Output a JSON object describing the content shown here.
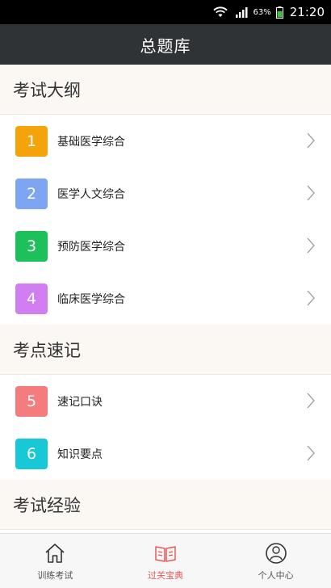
{
  "status_bar": {
    "battery_percent": "63%",
    "time": "21:20"
  },
  "header": {
    "title": "总题库"
  },
  "sections": [
    {
      "title": "考试大纲",
      "items": [
        {
          "number": "1",
          "label": "基础医学综合",
          "color": "#f5a30b"
        },
        {
          "number": "2",
          "label": "医学人文综合",
          "color": "#7da5f2"
        },
        {
          "number": "3",
          "label": "预防医学综合",
          "color": "#1dc159"
        },
        {
          "number": "4",
          "label": "临床医学综合",
          "color": "#d17ef2"
        }
      ]
    },
    {
      "title": "考点速记",
      "items": [
        {
          "number": "5",
          "label": "速记口诀",
          "color": "#f57c7c"
        },
        {
          "number": "6",
          "label": "知识要点",
          "color": "#18c8d6"
        }
      ]
    },
    {
      "title": "考试经验",
      "items": []
    }
  ],
  "tabs": [
    {
      "label": "训练考试",
      "icon": "home-icon",
      "active": false
    },
    {
      "label": "过关宝典",
      "icon": "book-icon",
      "active": true,
      "color": "#e85a5a"
    },
    {
      "label": "个人中心",
      "icon": "person-icon",
      "active": false
    }
  ]
}
